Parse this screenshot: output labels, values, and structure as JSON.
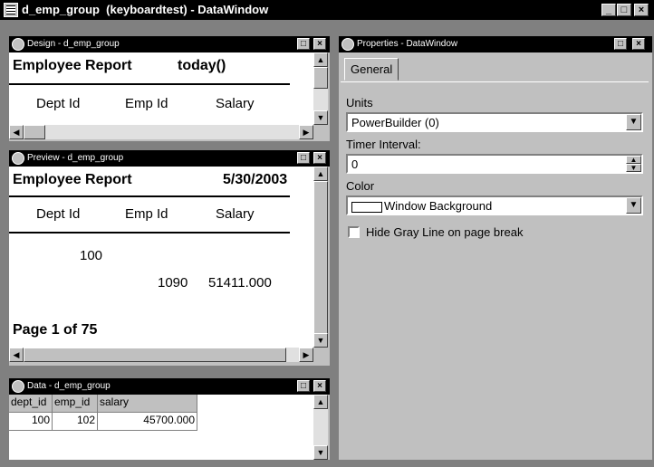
{
  "window": {
    "title": "d_emp_group  (keyboardtest) - DataWindow",
    "buttons": [
      "_",
      "□",
      "×"
    ]
  },
  "design": {
    "title": "Design - d_emp_group",
    "report_title": "Employee Report",
    "date_expr": "today()",
    "headers": [
      "Dept Id",
      "Emp Id",
      "Salary"
    ]
  },
  "preview": {
    "title": "Preview - d_emp_group",
    "report_title": "Employee Report",
    "date": "5/30/2003",
    "headers": [
      "Dept Id",
      "Emp Id",
      "Salary"
    ],
    "group_dept": "100",
    "row": {
      "emp_id": "1090",
      "salary": "51411.000"
    },
    "page_text": "Page 1 of 75"
  },
  "data": {
    "title": "Data - d_emp_group",
    "columns": [
      "dept_id",
      "emp_id",
      "salary"
    ],
    "rows": [
      {
        "dept_id": "100",
        "emp_id": "102",
        "salary": "45700.000"
      }
    ]
  },
  "properties": {
    "title": "Properties - DataWindow",
    "tab": "General",
    "units_label": "Units",
    "units_value": "PowerBuilder (0)",
    "timer_label": "Timer Interval:",
    "timer_value": "0",
    "color_label": "Color",
    "color_value": "Window Background",
    "hide_gray_label": "Hide Gray Line on page break",
    "hide_gray_checked": false
  },
  "colors": {
    "title_bar": "#000000",
    "face": "#c0c0c0",
    "canvas": "#ffffff"
  }
}
